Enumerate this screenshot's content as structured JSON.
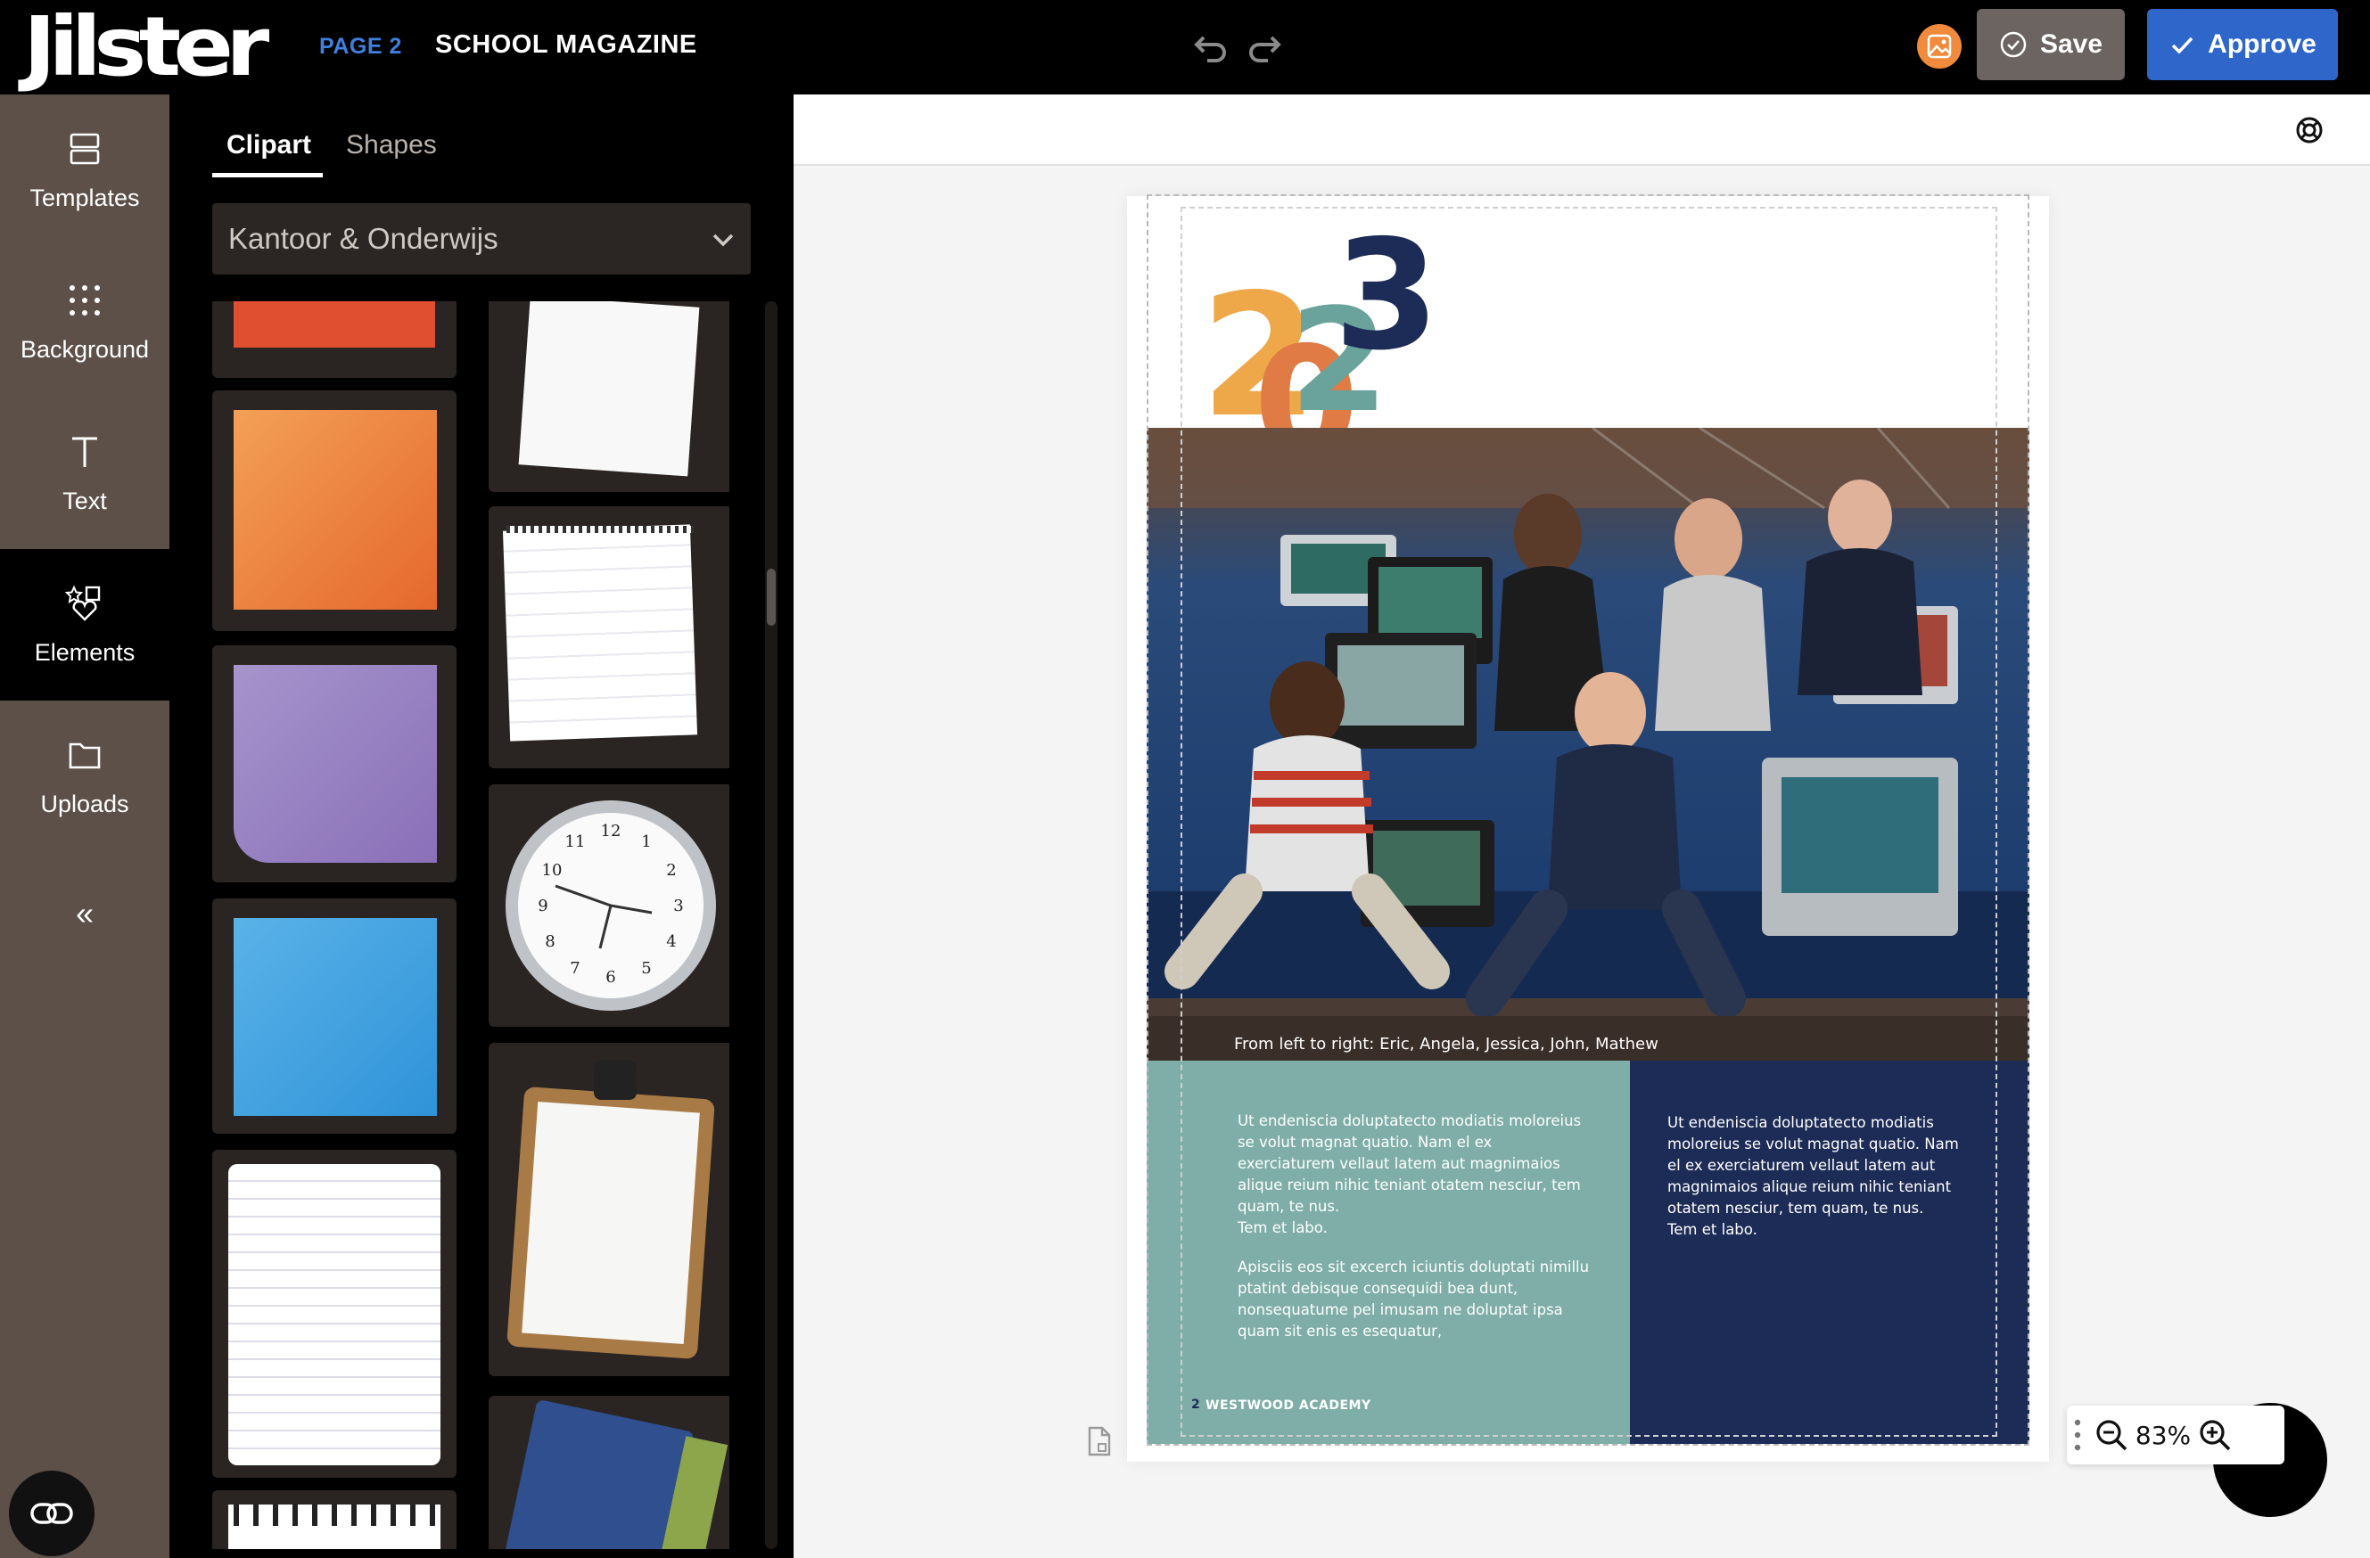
{
  "app": {
    "logo": "Jilster",
    "page_label": "PAGE 2",
    "title": "SCHOOL MAGAZINE"
  },
  "toolbar": {
    "save_label": "Save",
    "approve_label": "Approve",
    "undo_icon": "undo-icon",
    "redo_icon": "redo-icon",
    "image_icon": "image-icon"
  },
  "nav": {
    "items": [
      {
        "label": "Templates",
        "icon": "templates-icon"
      },
      {
        "label": "Background",
        "icon": "background-icon"
      },
      {
        "label": "Text",
        "icon": "text-icon"
      },
      {
        "label": "Elements",
        "icon": "elements-icon",
        "active": true
      },
      {
        "label": "Uploads",
        "icon": "uploads-icon"
      }
    ],
    "collapse_label": "«"
  },
  "panel": {
    "tabs": [
      {
        "label": "Clipart",
        "active": true
      },
      {
        "label": "Shapes"
      }
    ],
    "category": "Kantoor & Onderwijs",
    "clipart": [
      "red sticky note",
      "white paper sheet",
      "orange sticky note",
      "spiral notepad",
      "purple sticky note",
      "wall clock",
      "blue sticky note",
      "clipboard",
      "lined paper",
      "blue notebook",
      "spiral notebook"
    ]
  },
  "canvas": {
    "year": "2023",
    "caption": "From left to right: Eric, Angela, Jessica, John, Mathew",
    "left_text_1": "Ut endeniscia doluptatecto modiatis moloreius se volut magnat quatio. Nam el ex exerciaturem vellaut latem aut magnimaios alique reium nihic teniant otatem nesciur, tem quam, te nus.\nTem et labo.",
    "left_text_2": "Apisciis eos sit excerch iciuntis doluptati nimillu ptatint debisque consequidi bea dunt, nonsequatume pel imusam ne doluptat ipsa quam sit enis es esequatur,",
    "right_text": "Ut endeniscia doluptatecto modiatis moloreius se volut magnat quatio. Nam el ex exerciaturem vellaut latem aut magnimaios alique reium nihic teniant otatem nesciur, tem quam, te nus.\nTem et labo.",
    "footer_page": "2",
    "footer_school": "WESTWOOD ACADEMY",
    "year_colors": [
      "#eea84a",
      "#e07b45",
      "#6aa39b",
      "#1c2c56"
    ]
  },
  "zoom": {
    "value": "83%"
  }
}
